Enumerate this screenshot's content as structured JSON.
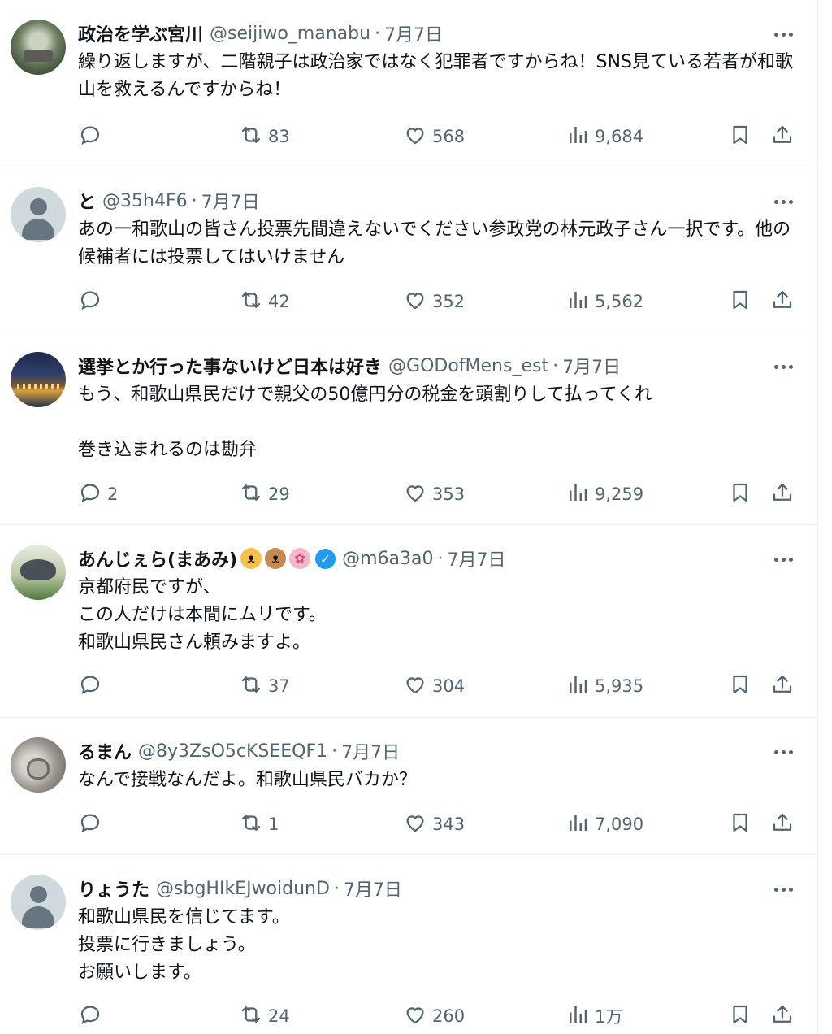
{
  "tweets": [
    {
      "name": "政治を学ぶ宮川",
      "handle": "@seijiwo_manabu",
      "date": "7月7日",
      "text": [
        "繰り返しますが、二階親子は政治家ではなく犯罪者ですからね！SNS見ている若者が和歌山を救えるんですからね！"
      ],
      "replies": "",
      "retweets": "83",
      "likes": "568",
      "views": "9,684",
      "avatar": "garden-photo"
    },
    {
      "name": "と",
      "handle": "@35h4F6",
      "date": "7月7日",
      "text": [
        "あの一和歌山の皆さん投票先間違えないでください参政党の林元政子さん一択です。他の候補者には投票してはいけません"
      ],
      "replies": "",
      "retweets": "42",
      "likes": "352",
      "views": "5,562",
      "avatar": "default-avatar"
    },
    {
      "name": "選挙とか行った事ないけど日本は好き",
      "handle": "@GODofMens_est",
      "date": "7月7日",
      "text": [
        "もう、和歌山県民だけで親父の50億円分の税金を頭割りして払ってくれ",
        "",
        "巻き込まれるのは勘弁"
      ],
      "replies": "2",
      "retweets": "29",
      "likes": "353",
      "views": "9,259",
      "avatar": "night-city-photo"
    },
    {
      "name": "あんじぇら(まあみ)",
      "handle": "@m6a3a0",
      "date": "7月7日",
      "emojis": [
        "cat-face-icon",
        "dog-face-icon",
        "cherry-blossom-icon"
      ],
      "verified": true,
      "text": [
        "京都府民ですが、",
        "この人だけは本間にムリです。",
        "和歌山県民さん頼みますよ。"
      ],
      "replies": "",
      "retweets": "37",
      "likes": "304",
      "views": "5,935",
      "avatar": "animal-photo"
    },
    {
      "name": "るまん",
      "handle": "@8y3ZsO5cKSEEQF1",
      "date": "7月7日",
      "text": [
        "なんで接戦なんだよ。和歌山県民バカか？"
      ],
      "replies": "",
      "retweets": "1",
      "likes": "343",
      "views": "7,090",
      "avatar": "cat-paw-photo"
    },
    {
      "name": "りょうた",
      "handle": "@sbgHIkEJwoidunD",
      "date": "7月7日",
      "text": [
        "和歌山県民を信じてます。",
        "投票に行きましょう。",
        "お願いします。"
      ],
      "replies": "",
      "retweets": "24",
      "likes": "260",
      "views": "1万",
      "avatar": "default-avatar"
    }
  ],
  "separator": "·",
  "colors": {
    "text": "#0f1419",
    "secondary": "#536471",
    "border": "#eff3f4",
    "verified": "#1d9bf0"
  }
}
